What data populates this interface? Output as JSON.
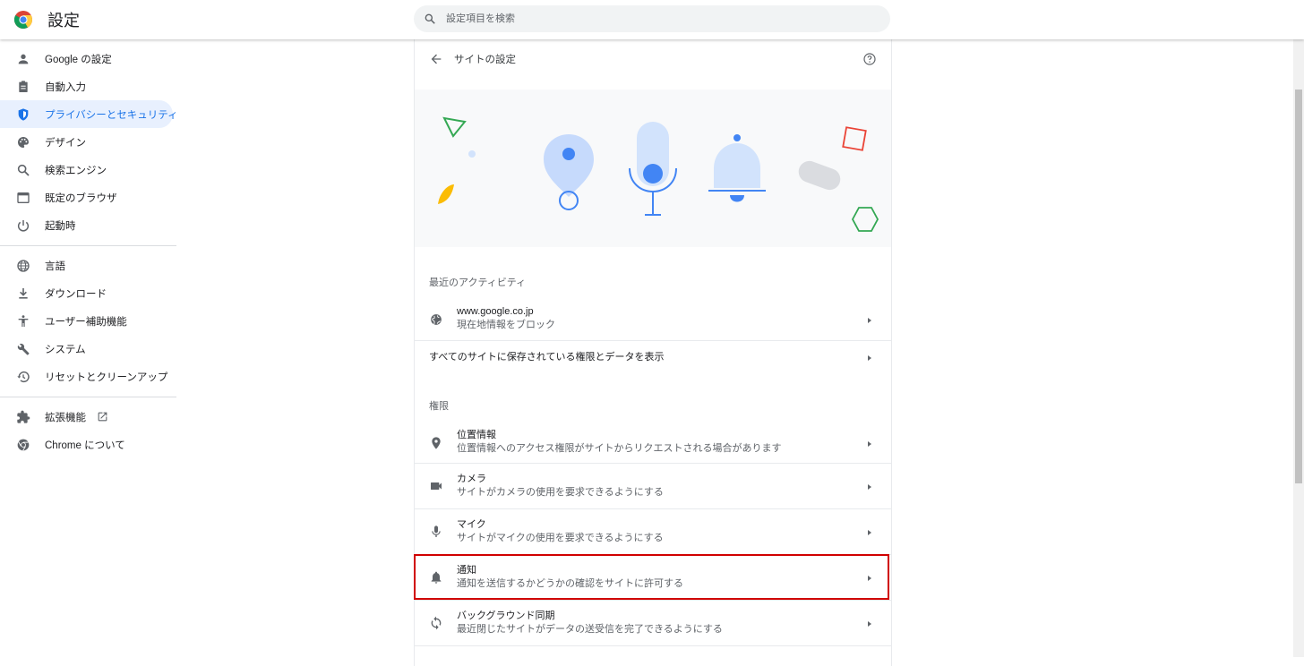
{
  "header": {
    "title": "設定",
    "search_placeholder": "設定項目を検索"
  },
  "sidebar": {
    "items": [
      {
        "label": "Google の設定",
        "icon": "person-icon"
      },
      {
        "label": "自動入力",
        "icon": "clipboard-icon"
      },
      {
        "label": "プライバシーとセキュリティ",
        "icon": "shield-icon",
        "active": true
      },
      {
        "label": "デザイン",
        "icon": "palette-icon"
      },
      {
        "label": "検索エンジン",
        "icon": "search-icon"
      },
      {
        "label": "既定のブラウザ",
        "icon": "browser-window-icon"
      },
      {
        "label": "起動時",
        "icon": "power-icon"
      },
      {
        "label": "言語",
        "icon": "globe-icon"
      },
      {
        "label": "ダウンロード",
        "icon": "download-icon"
      },
      {
        "label": "ユーザー補助機能",
        "icon": "accessibility-icon"
      },
      {
        "label": "システム",
        "icon": "wrench-icon"
      },
      {
        "label": "リセットとクリーンアップ",
        "icon": "restore-icon"
      },
      {
        "label": "拡張機能",
        "icon": "puzzle-icon"
      },
      {
        "label": "Chrome について",
        "icon": "chrome-icon"
      }
    ]
  },
  "main": {
    "title": "サイトの設定",
    "recent_section": "最近のアクティビティ",
    "recent_site": {
      "title": "www.google.co.jp",
      "subtitle": "現在地情報をブロック"
    },
    "all_sites": "すべてのサイトに保存されている権限とデータを表示",
    "permissions_section": "権限",
    "permissions": [
      {
        "title": "位置情報",
        "subtitle": "位置情報へのアクセス権限がサイトからリクエストされる場合があります",
        "icon": "location-pin-icon"
      },
      {
        "title": "カメラ",
        "subtitle": "サイトがカメラの使用を要求できるようにする",
        "icon": "camera-icon"
      },
      {
        "title": "マイク",
        "subtitle": "サイトがマイクの使用を要求できるようにする",
        "icon": "microphone-icon"
      },
      {
        "title": "通知",
        "subtitle": "通知を送信するかどうかの確認をサイトに許可する",
        "icon": "bell-icon",
        "highlighted": true
      },
      {
        "title": "バックグラウンド同期",
        "subtitle": "最近閉じたサイトがデータの送受信を完了できるようにする",
        "icon": "sync-icon"
      }
    ]
  },
  "colors": {
    "accent": "#1a73e8",
    "active_bg": "#e8f0fe",
    "highlight": "#d00000",
    "banner_bg": "#f8f9fa"
  }
}
